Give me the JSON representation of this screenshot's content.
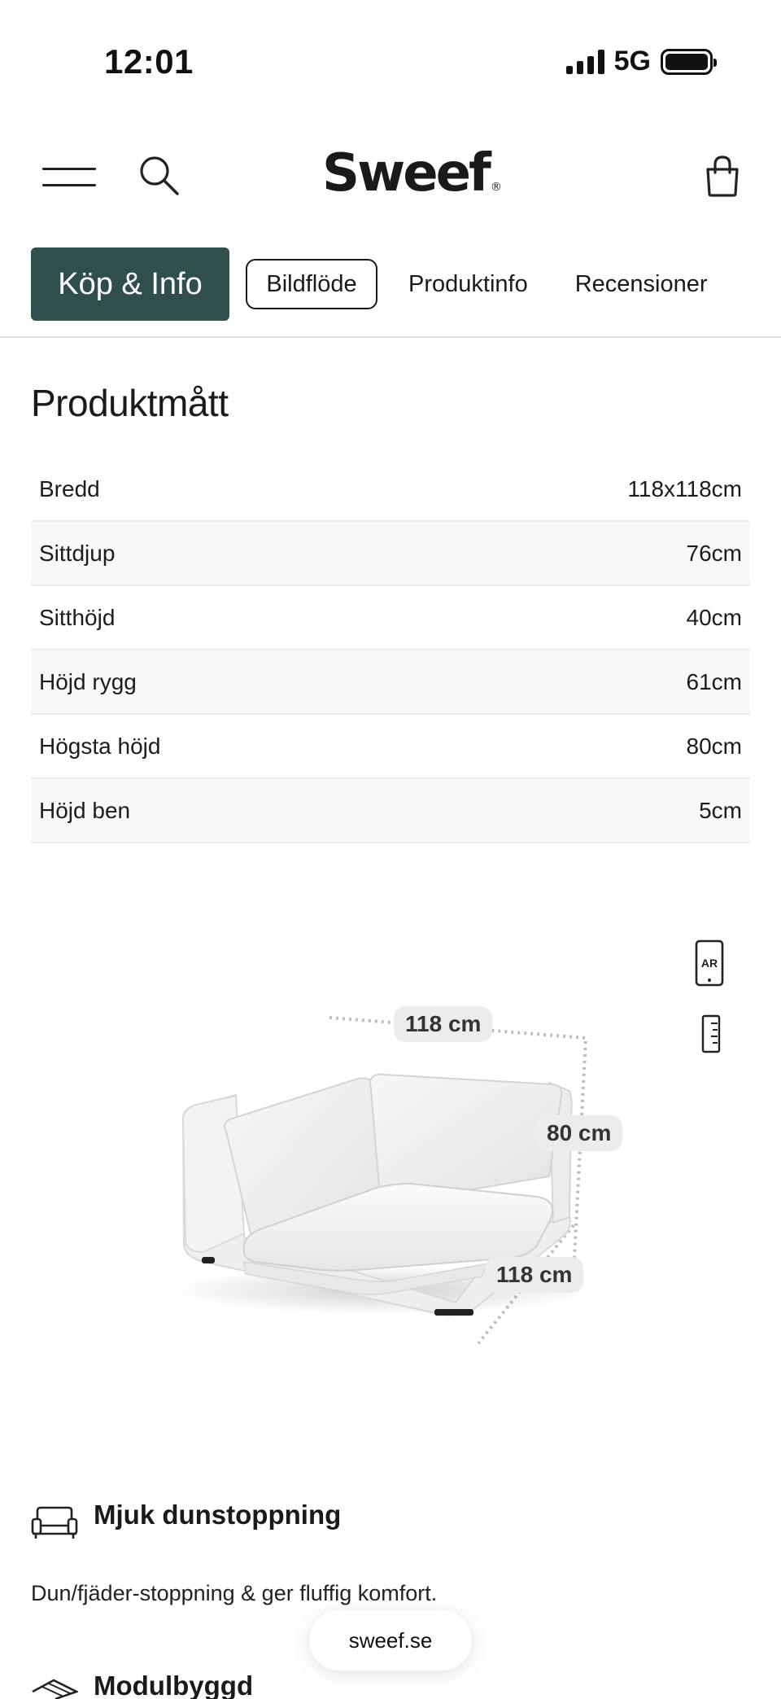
{
  "status_bar": {
    "time": "12:01",
    "network": "5G"
  },
  "header": {
    "logo": "Sweef",
    "logo_mark": "®",
    "icons": [
      "menu-icon",
      "search-icon",
      "shopping-bag-icon"
    ]
  },
  "tabs": [
    {
      "label": "Köp & Info",
      "active": true
    },
    {
      "label": "Bildflöde",
      "outlined": true
    },
    {
      "label": "Produktinfo"
    },
    {
      "label": "Recensioner"
    }
  ],
  "dimensions": {
    "title": "Produktmått",
    "rows": [
      {
        "label": "Bredd",
        "value": "118x118cm"
      },
      {
        "label": "Sittdjup",
        "value": "76cm"
      },
      {
        "label": "Sitthöjd",
        "value": "40cm"
      },
      {
        "label": "Höjd rygg",
        "value": "61cm"
      },
      {
        "label": "Högsta höjd",
        "value": "80cm"
      },
      {
        "label": "Höjd ben",
        "value": "5cm"
      }
    ]
  },
  "product_image": {
    "ar_label": "AR",
    "width_label": "118 cm",
    "height_label": "80 cm",
    "depth_label": "118 cm",
    "icons": [
      "ar-phone-icon",
      "ruler-icon"
    ]
  },
  "features": [
    {
      "icon": "sofa-icon",
      "title": "Mjuk dunstoppning",
      "description": "Dun/fjäder-stoppning & ger fluffig komfort."
    },
    {
      "icon": "modules-icon",
      "title": "Modulbyggd"
    }
  ],
  "browser": {
    "domain": "sweef.se"
  },
  "colors": {
    "accent": "#2f4f4c",
    "text": "#1a1a1a",
    "row_alt": "#f8f8f8"
  }
}
